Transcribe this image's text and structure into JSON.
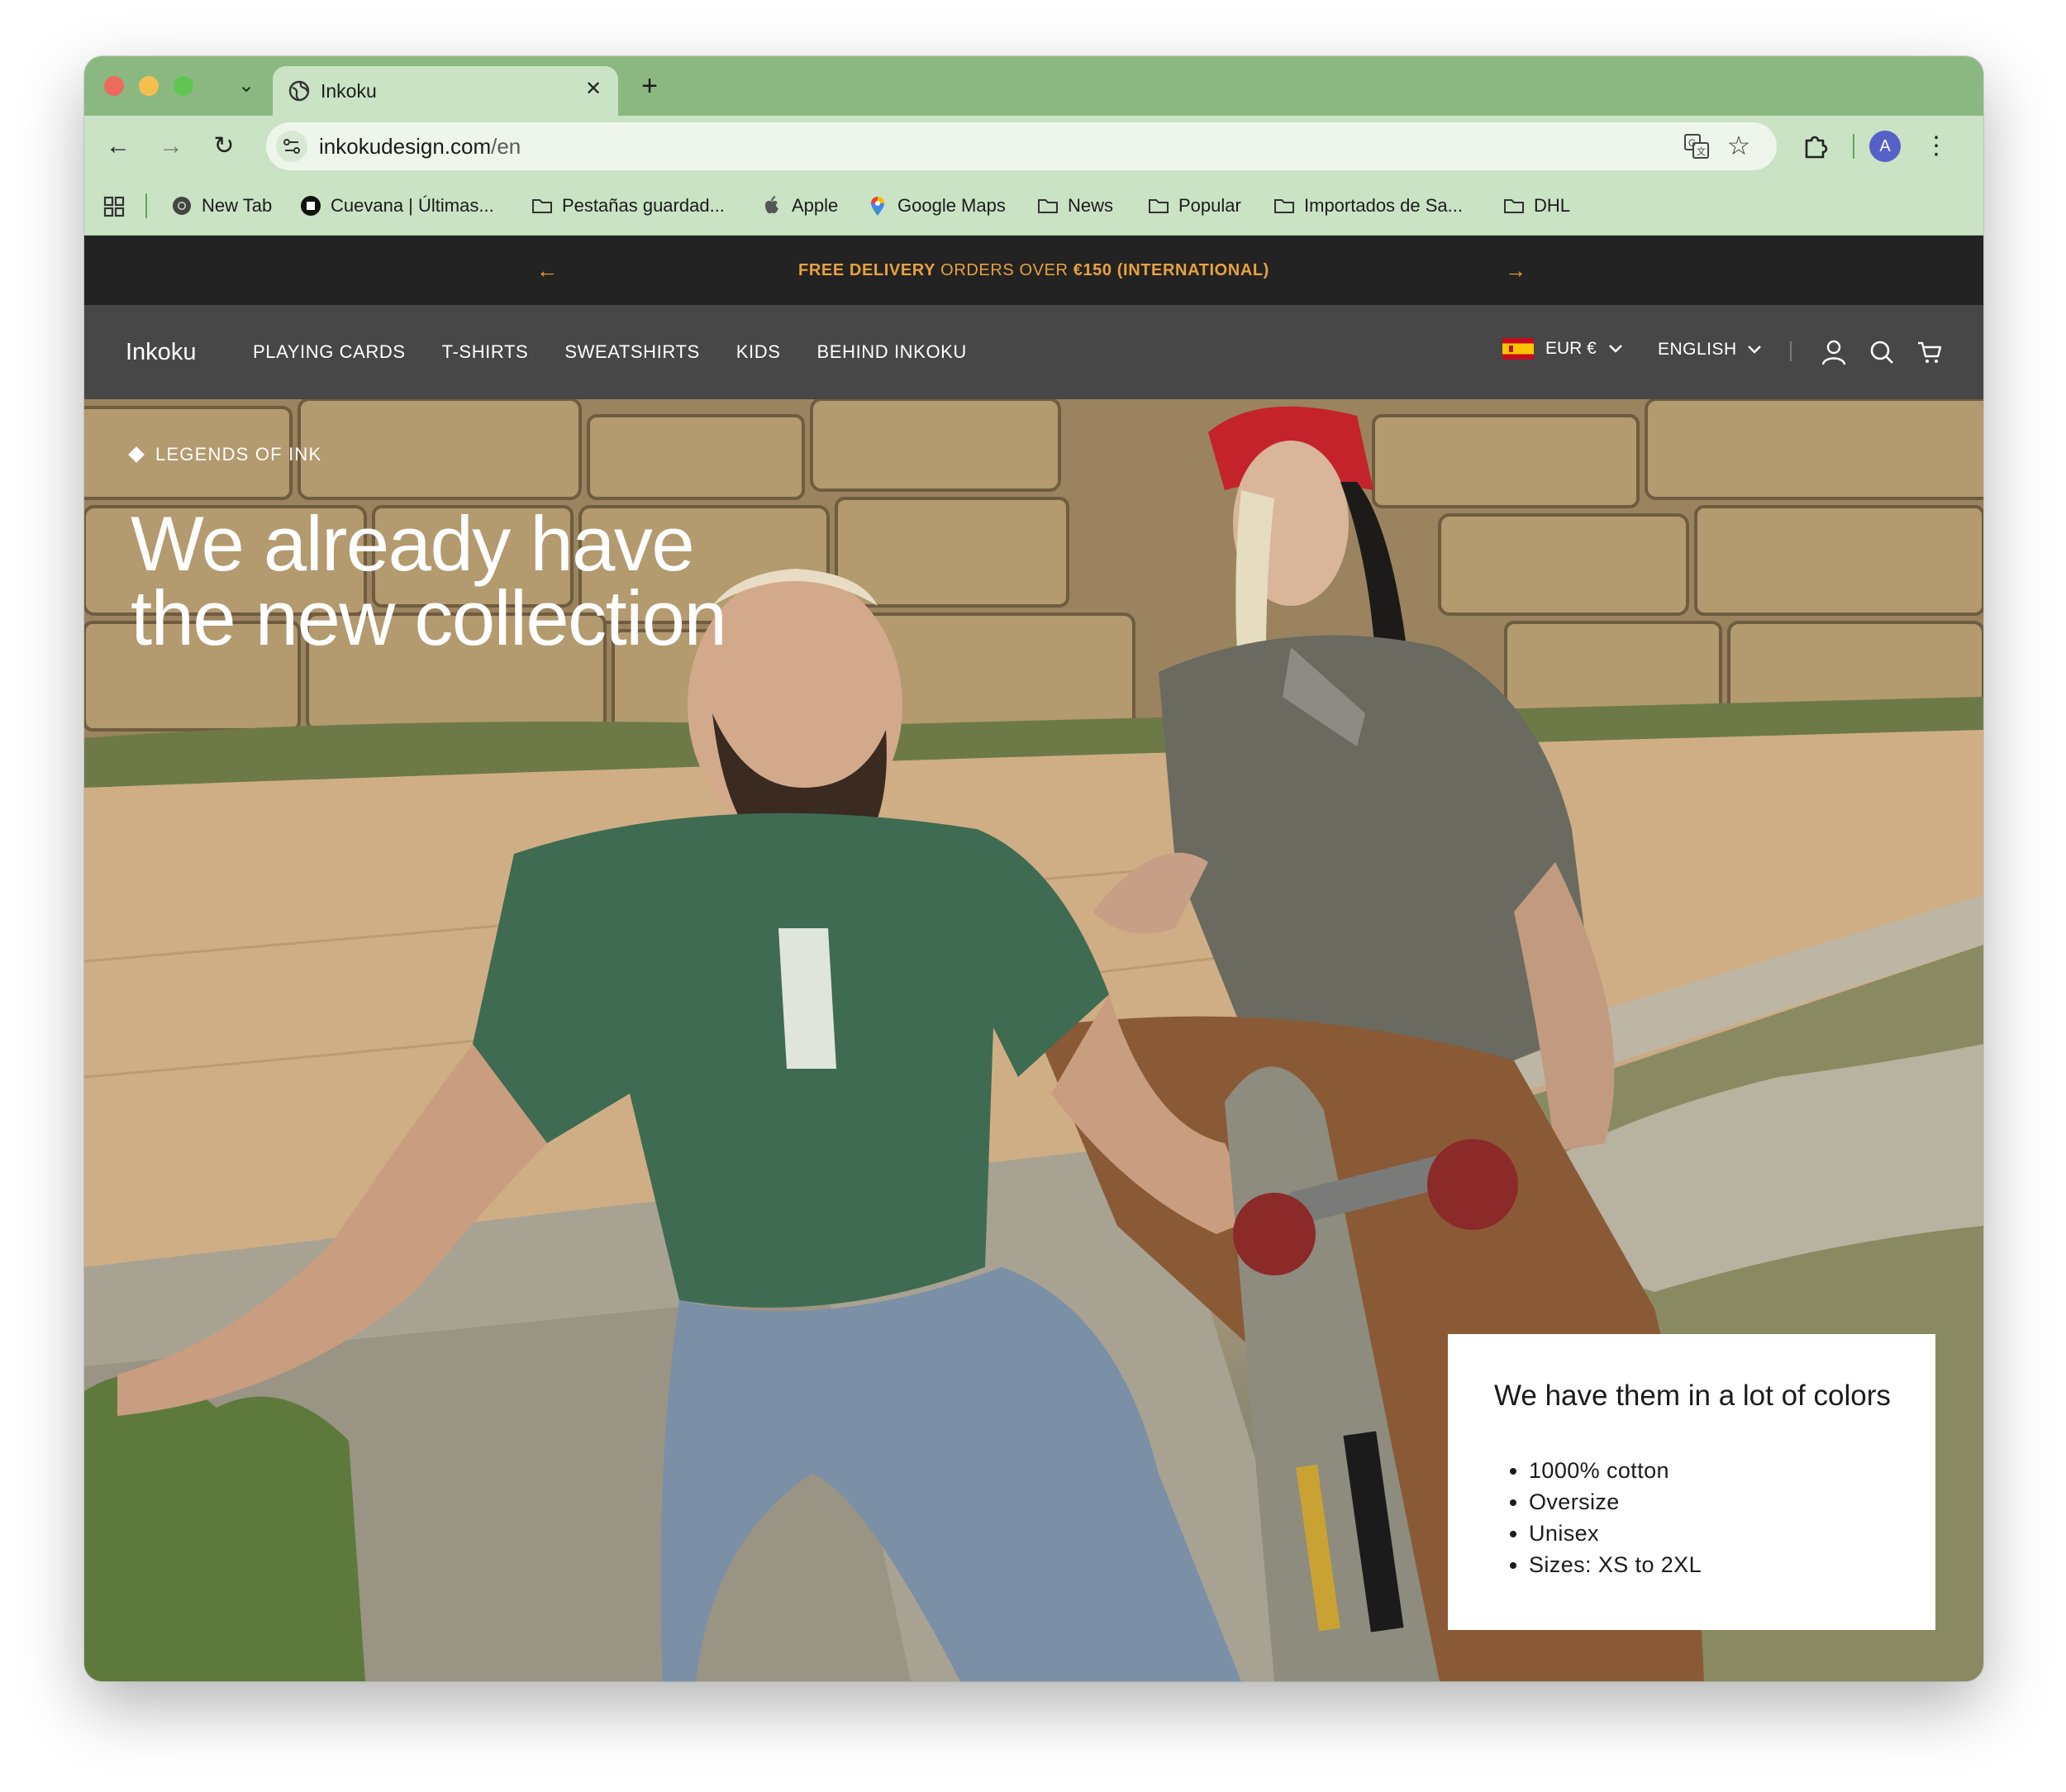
{
  "browser": {
    "tab": {
      "title": "Inkoku"
    },
    "url": {
      "domain": "inkokudesign.com",
      "path": "/en"
    },
    "profile_initial": "A",
    "bookmarks": [
      {
        "label": "New Tab",
        "icon": "chrome-icon"
      },
      {
        "label": "Cuevana | Últimas...",
        "icon": "cuevana-icon"
      },
      {
        "label": "Pestañas guardad...",
        "icon": "folder-icon"
      },
      {
        "label": "Apple",
        "icon": "apple-icon"
      },
      {
        "label": "Google Maps",
        "icon": "maps-pin-icon"
      },
      {
        "label": "News",
        "icon": "folder-icon"
      },
      {
        "label": "Popular",
        "icon": "folder-icon"
      },
      {
        "label": "Importados de Sa...",
        "icon": "folder-icon"
      },
      {
        "label": "DHL",
        "icon": "folder-icon"
      }
    ]
  },
  "announcement": {
    "bold_lead": "FREE DELIVERY",
    "middle": " ORDERS OVER ",
    "bold_tail": "€150 (INTERNATIONAL)"
  },
  "site": {
    "logo": "Inkoku",
    "nav": [
      "PLAYING CARDS",
      "T-SHIRTS",
      "SWEATSHIRTS",
      "KIDS",
      "BEHIND INKOKU"
    ],
    "currency": "EUR €",
    "language": "ENGLISH"
  },
  "hero": {
    "eyebrow": "LEGENDS OF INK",
    "headline_line1": "We already have",
    "headline_line2": "the new collection",
    "card": {
      "title": "We have them in a lot of colors",
      "features": [
        "1000% cotton",
        "Oversize",
        "Unisex",
        "Sizes: XS to 2XL"
      ]
    }
  },
  "colors": {
    "tab_strip": "#8bb880",
    "toolbar": "#c9e3c4",
    "announcement_bg": "#232323",
    "announcement_text": "#e8a23c",
    "nav_bg": "#474747"
  }
}
